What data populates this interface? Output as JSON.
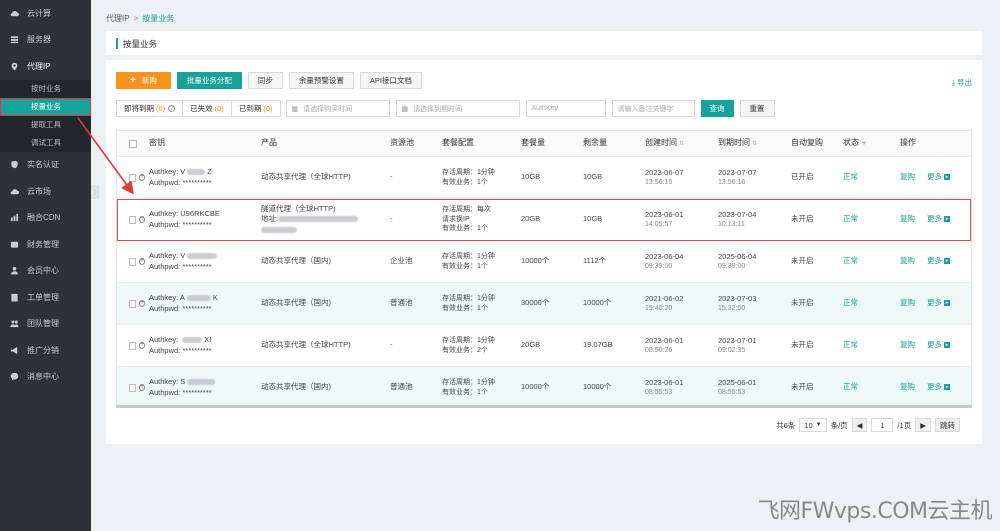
{
  "sidebar": {
    "items": [
      {
        "label": "云计算",
        "icon": "cloud-icon"
      },
      {
        "label": "服务器",
        "icon": "server-icon"
      },
      {
        "label": "代理IP",
        "icon": "location-pin-icon"
      },
      {
        "label": "实名认证",
        "icon": "shield-icon"
      },
      {
        "label": "云市场",
        "icon": "cloud-market-icon"
      },
      {
        "label": "融合CDN",
        "icon": "cdn-icon"
      },
      {
        "label": "财务管理",
        "icon": "wallet-icon"
      },
      {
        "label": "会员中心",
        "icon": "user-icon"
      },
      {
        "label": "工单管理",
        "icon": "ticket-icon"
      },
      {
        "label": "团队管理",
        "icon": "team-icon"
      },
      {
        "label": "推广分销",
        "icon": "megaphone-icon"
      },
      {
        "label": "消息中心",
        "icon": "message-icon"
      }
    ],
    "sub_items": [
      "按时业务",
      "按量业务",
      "提取工具",
      "调试工具"
    ]
  },
  "breadcrumb": {
    "root": "代理IP",
    "sep": ">",
    "current": "按量业务"
  },
  "page_title": "按量业务",
  "toolbar": {
    "new_label": "新购",
    "batch_label": "批量业务分配",
    "sync_label": "同步",
    "balance_label": "余量预警设置",
    "api_label": "API接口文档",
    "export_label": "导出"
  },
  "filters": {
    "expiring": {
      "label": "即将到期",
      "count": "(0)"
    },
    "invalid": {
      "label": "已失效",
      "count": "(0)"
    },
    "expired": {
      "label": "已到期",
      "count": "(0)"
    },
    "buy_time_placeholder": "请选择购买时间",
    "expire_time_placeholder": "请选择到期时间",
    "authkey_placeholder": "AuthKey",
    "remark_placeholder": "请输入备注关键字",
    "query_label": "查询",
    "reset_label": "重置"
  },
  "table": {
    "headers": {
      "key": "密钥",
      "product": "产品",
      "pool": "资源池",
      "config": "套餐配置",
      "package": "套餐量",
      "remaining": "剩余量",
      "created": "创建时间",
      "expire": "到期时间",
      "auto": "自动复购",
      "status": "状态",
      "ops": "操作"
    },
    "rows": [
      {
        "authkey": "Authkey: V",
        "authkey_tail": "Z",
        "authpwd": "Authpwd: **********",
        "product1": "动态共享代理（全球HTTP)",
        "product2": "",
        "product3": "",
        "pool": "-",
        "cfg1": "存活周期：1分钟",
        "cfg2": "有效业务：1个",
        "cfg3": "",
        "pkg": "10GB",
        "rem": "10GB",
        "cdate": "2023-06-07",
        "ctime": "13:56:16",
        "edate": "2023-07-07",
        "etime": "13:56:16",
        "auto": "已开启",
        "status": "正常",
        "op1": "复购",
        "op2": "更多"
      },
      {
        "authkey": "Authkey: U96RKCBE",
        "authkey_tail": "",
        "authpwd": "Authpwd: **********",
        "product1": "隧道代理（全球HTTP)",
        "product2": "地址:",
        "product3": "",
        "pool": "-",
        "cfg1": "存活周期：每次",
        "cfg2": "请求换IP",
        "cfg3": "有效业务：1个",
        "pkg": "20GB",
        "rem": "10GB",
        "cdate": "2023-06-01",
        "ctime": "14:05:57",
        "edate": "2023-07-04",
        "etime": "10:13:11",
        "auto": "未开启",
        "status": "正常",
        "op1": "复购",
        "op2": "更多"
      },
      {
        "authkey": "Authkey: V",
        "authkey_tail": "",
        "authpwd": "Authpwd: **********",
        "product1": "动态共享代理（国内)",
        "product2": "",
        "product3": "",
        "pool": "企业池",
        "cfg1": "存活周期：1分钟",
        "cfg2": "有效业务：1个",
        "cfg3": "",
        "pkg": "10000个",
        "rem": "1112个",
        "cdate": "2023-06-04",
        "ctime": "09:39:00",
        "edate": "2025-06-04",
        "etime": "09:39:00",
        "auto": "未开启",
        "status": "正常",
        "op1": "复购",
        "op2": "更多"
      },
      {
        "authkey": "Authkey: A",
        "authkey_tail": "K",
        "authpwd": "Authpwd: **********",
        "product1": "动态共享代理（国内)",
        "product2": "",
        "product3": "",
        "pool": "普通池",
        "cfg1": "存活周期：1分钟",
        "cfg2": "有效业务：1个",
        "cfg3": "",
        "pkg": "30000个",
        "rem": "10000个",
        "cdate": "2021-06-02",
        "ctime": "15:40:20",
        "edate": "2023-07-03",
        "etime": "15:32:00",
        "auto": "未开启",
        "status": "正常",
        "op1": "复购",
        "op2": "更多"
      },
      {
        "authkey": "Authkey: ",
        "authkey_tail": "XI",
        "authpwd": "Authpwd: **********",
        "product1": "动态共享代理（全球HTTP)",
        "product2": "",
        "product3": "",
        "pool": "-",
        "cfg1": "存活周期：1分钟",
        "cfg2": "有效业务：2个",
        "cfg3": "",
        "pkg": "20GB",
        "rem": "19.07GB",
        "cdate": "2023-06-01",
        "ctime": "08:50:26",
        "edate": "2023-07-01",
        "etime": "09:02:35",
        "auto": "未开启",
        "status": "正常",
        "op1": "复购",
        "op2": "更多"
      },
      {
        "authkey": "Authkey: S",
        "authkey_tail": "",
        "authpwd": "Authpwd: **********",
        "product1": "动态共享代理（国内)",
        "product2": "",
        "product3": "",
        "pool": "普通池",
        "cfg1": "存活周期：1分钟",
        "cfg2": "有效业务：1个",
        "cfg3": "",
        "pkg": "10000个",
        "rem": "10000个",
        "cdate": "2023-06-01",
        "ctime": "08:55:53",
        "edate": "2025-06-01",
        "etime": "08:55:53",
        "auto": "未开启",
        "status": "正常",
        "op1": "复购",
        "op2": "更多"
      }
    ]
  },
  "pager": {
    "total": "共6条",
    "size": "10",
    "per": "条/页",
    "page": "1",
    "pages": "/1页",
    "goto": "跳转"
  },
  "watermark": "飞网FWvps.COM云主机",
  "colors": {
    "accent": "#17a39b",
    "orange": "#f7941d",
    "sidebar": "#2c313a",
    "highlight": "#e14d4d"
  }
}
